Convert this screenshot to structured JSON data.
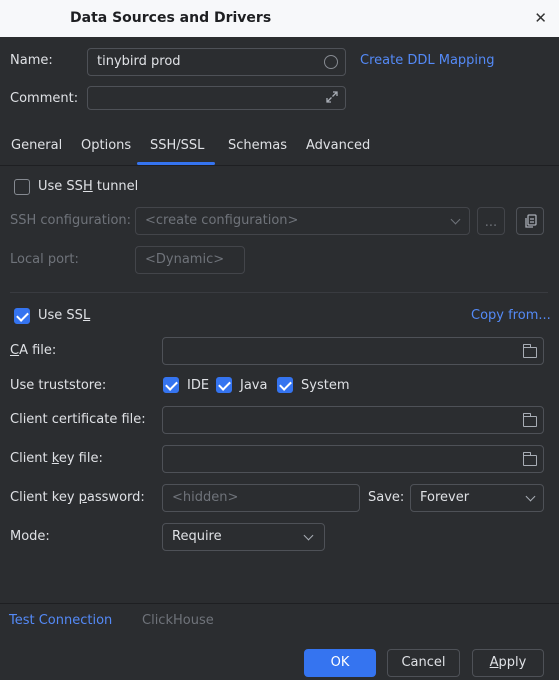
{
  "window": {
    "title": "Data Sources and Drivers",
    "close_glyph": "✕"
  },
  "name_row": {
    "label": "Name:",
    "value": "tinybird prod",
    "ddl_link": "Create DDL Mapping"
  },
  "comment_row": {
    "label": "Comment:",
    "value": ""
  },
  "tabs": [
    {
      "label": "General"
    },
    {
      "label": "Options"
    },
    {
      "label": "SSH/SSL",
      "active": true
    },
    {
      "label": "Schemas"
    },
    {
      "label": "Advanced"
    }
  ],
  "ssh": {
    "use_ssh_label_pre": "Use SS",
    "use_ssh_label_u": "H",
    "use_ssh_label_post": " tunnel",
    "use_ssh_checked": false,
    "config_label": "SSH configuration:",
    "config_value": "<create configuration>",
    "more_glyph": "...",
    "local_port_label": "Local port:",
    "local_port_placeholder": "<Dynamic>"
  },
  "ssl": {
    "use_ssl_label_pre": "Use SS",
    "use_ssl_label_u": "L",
    "use_ssl_checked": true,
    "copy_from": "Copy from...",
    "ca_label_u": "C",
    "ca_label_post": "A file:",
    "truststore_label": "Use truststore:",
    "truststore_options": [
      {
        "label": "IDE",
        "checked": true
      },
      {
        "label": "Java",
        "checked": true
      },
      {
        "label": "System",
        "checked": true
      }
    ],
    "client_cert_label": "Client certificate file:",
    "client_key_label_pre": "Client ",
    "client_key_label_u": "k",
    "client_key_label_post": "ey file:",
    "client_key_pw_label_pre": "Client key ",
    "client_key_pw_label_u": "p",
    "client_key_pw_label_post": "assword:",
    "password_placeholder": "<hidden>",
    "save_label": "Save:",
    "save_value": "Forever",
    "mode_label": "Mode:",
    "mode_value": "Require"
  },
  "footer": {
    "test_connection": "Test Connection",
    "driver": "ClickHouse",
    "ok": "OK",
    "cancel": "Cancel",
    "apply_u": "A",
    "apply_post": "pply"
  },
  "colors": {
    "accent": "#3574f0",
    "link": "#548af7",
    "background": "#2b2d30"
  }
}
